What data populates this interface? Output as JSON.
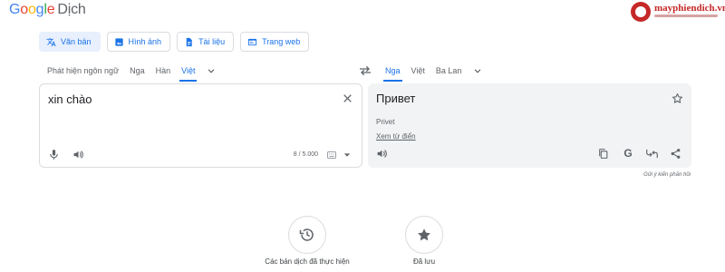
{
  "app": {
    "logo_letters": [
      "G",
      "o",
      "o",
      "g",
      "l",
      "e"
    ],
    "product": "Dịch",
    "watermark": "mayphiendich.vn"
  },
  "modes": [
    {
      "label": "Văn bản",
      "icon": "translate-icon",
      "active": true
    },
    {
      "label": "Hình ảnh",
      "icon": "image-icon",
      "active": false
    },
    {
      "label": "Tài liệu",
      "icon": "document-icon",
      "active": false
    },
    {
      "label": "Trang web",
      "icon": "website-icon",
      "active": false
    }
  ],
  "source_langs": [
    {
      "label": "Phát hiện ngôn ngữ",
      "selected": false
    },
    {
      "label": "Nga",
      "selected": false
    },
    {
      "label": "Hàn",
      "selected": false
    },
    {
      "label": "Việt",
      "selected": true
    }
  ],
  "target_langs": [
    {
      "label": "Nga",
      "selected": true
    },
    {
      "label": "Việt",
      "selected": false
    },
    {
      "label": "Ba Lan",
      "selected": false
    }
  ],
  "source": {
    "text": "xin chào",
    "char_count": "8 / 5.000"
  },
  "target": {
    "text": "Привет",
    "transliteration": "Privet",
    "dictionary_link": "Xem từ điển",
    "g_label": "G"
  },
  "feedback": "Gửi ý kiến phản hồi",
  "bottom": {
    "history_label": "Các bản dịch đã thực hiện",
    "saved_label": "Đã lưu"
  },
  "colors": {
    "accent": "#1a73e8",
    "active_bg": "#e8f0fe",
    "target_bg": "#f1f3f4",
    "icon": "#5f6368"
  }
}
